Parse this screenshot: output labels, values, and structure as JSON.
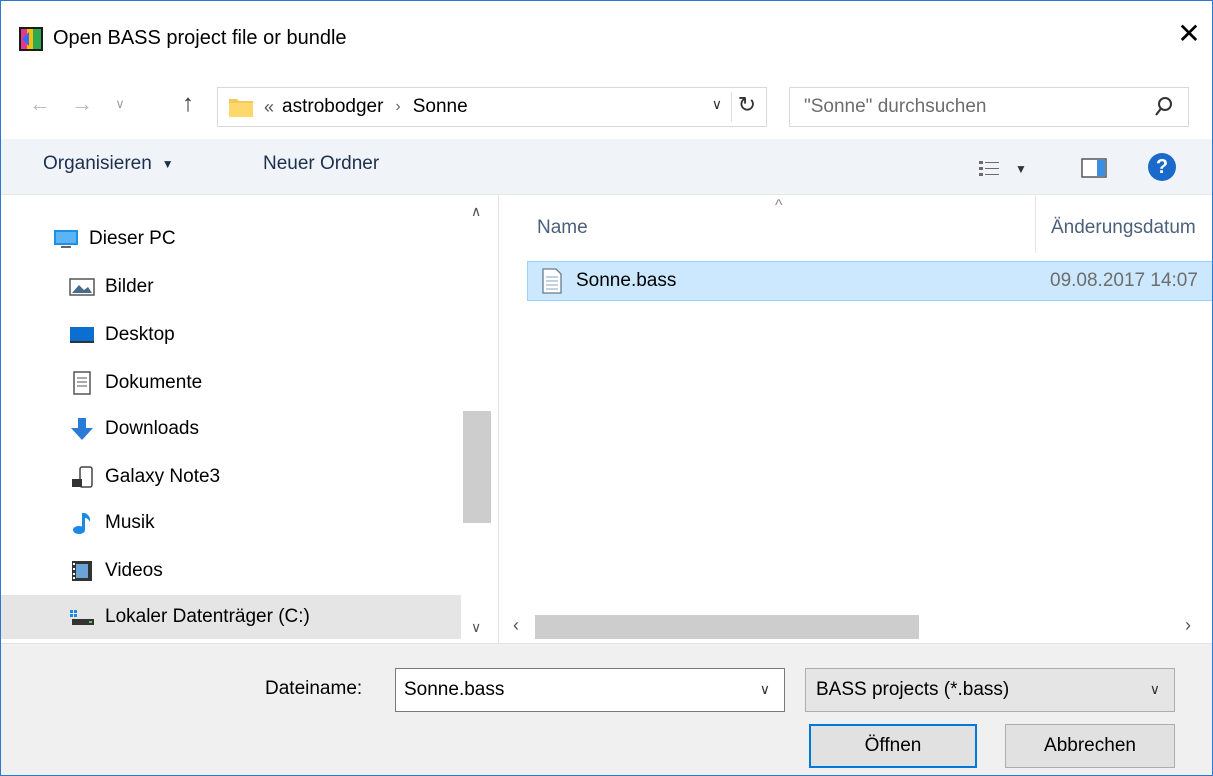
{
  "window": {
    "title": "Open BASS project file or bundle"
  },
  "nav": {
    "breadcrumb_overflow": "«",
    "breadcrumb": [
      "astrobodger",
      "Sonne"
    ],
    "breadcrumb_separator": "›"
  },
  "search": {
    "placeholder": "\"Sonne\" durchsuchen"
  },
  "toolbar": {
    "organize_label": "Organisieren",
    "new_folder_label": "Neuer Ordner",
    "help_label": "?"
  },
  "sidebar": {
    "items": [
      {
        "label": "Dieser PC",
        "icon": "computer-icon"
      },
      {
        "label": "Bilder",
        "icon": "pictures-icon"
      },
      {
        "label": "Desktop",
        "icon": "desktop-icon"
      },
      {
        "label": "Dokumente",
        "icon": "documents-icon"
      },
      {
        "label": "Downloads",
        "icon": "downloads-icon"
      },
      {
        "label": "Galaxy Note3",
        "icon": "phone-icon"
      },
      {
        "label": "Musik",
        "icon": "music-icon"
      },
      {
        "label": "Videos",
        "icon": "videos-icon"
      },
      {
        "label": "Lokaler Datenträger (C:)",
        "icon": "drive-icon"
      }
    ]
  },
  "file_list": {
    "columns": [
      "Name",
      "Änderungsdatum"
    ],
    "rows": [
      {
        "name": "Sonne.bass",
        "modified": "09.08.2017 14:07"
      }
    ]
  },
  "bottom": {
    "filename_label": "Dateiname:",
    "filename_value": "Sonne.bass",
    "filetype_value": "BASS projects (*.bass)",
    "open_label": "Öffnen",
    "cancel_label": "Abbrechen"
  },
  "colors": {
    "accent": "#0078d7",
    "selection_bg": "#cce8ff",
    "toolbar_bg": "#f0f4f9"
  }
}
